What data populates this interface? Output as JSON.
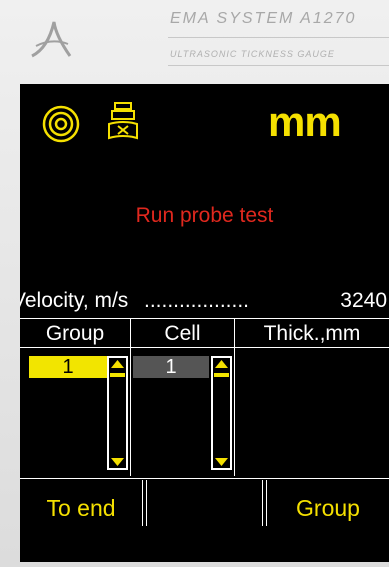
{
  "header": {
    "brand_title": "EMA SYSTEM A1270",
    "brand_subtitle": "ULTRASONIC TICKNESS GAUGE"
  },
  "status": {
    "icons": [
      "target-icon",
      "probe-test-icon"
    ],
    "units": "mm"
  },
  "message": "Run probe test",
  "velocity": {
    "label": "Velocity, m/s",
    "dots": "..................",
    "value": "3240"
  },
  "table": {
    "columns": [
      "Group",
      "Cell",
      "Thick.,mm"
    ],
    "group_value": "1",
    "cell_value": "1"
  },
  "softkeys": [
    "To end",
    "",
    "Group"
  ],
  "colors": {
    "accent_yellow": "#f5e000",
    "message_red": "#e0281e",
    "screen_bg": "#000000"
  }
}
